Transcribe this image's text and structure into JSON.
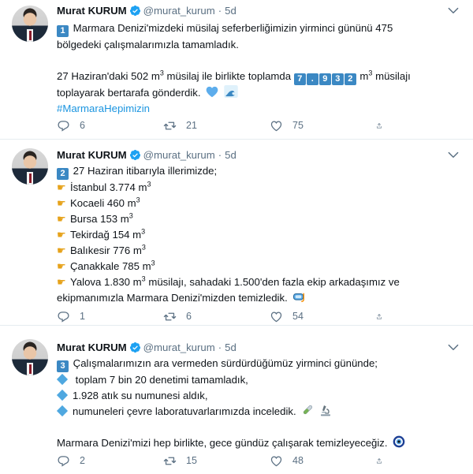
{
  "tweets": [
    {
      "name": "Murat KURUM",
      "handle": "@murat_kurum",
      "dot": "·",
      "time": "5d",
      "number_badge": "1",
      "lines": [
        "Marmara Denizi'mizdeki müsilaj seferberliğimizin yirminci gününü 475",
        "bölgedeki çalışmalarımızla tamamladık.",
        "27 Haziran'daki 502 m",
        " müsilaj ile birlikte toplamda ",
        " m",
        " müsilajı",
        "toplayarak bertarafa gönderdik."
      ],
      "superscript": "3",
      "total_digits": [
        "7",
        ".",
        "9",
        "3",
        "2"
      ],
      "hashtag": "#MarmaraHepimizin",
      "replies": "6",
      "retweets": "21",
      "likes": "75"
    },
    {
      "name": "Murat KURUM",
      "handle": "@murat_kurum",
      "dot": "·",
      "time": "5d",
      "number_badge": "2",
      "intro": "27 Haziran itibarıyla illerimizde;",
      "cities": [
        {
          "label": "İstanbul 3.774 m"
        },
        {
          "label": "Kocaeli 460 m"
        },
        {
          "label": "Bursa 153 m"
        },
        {
          "label": "Tekirdağ 154 m"
        },
        {
          "label": "Balıkesir 776 m"
        },
        {
          "label": "Çanakkale 785 m"
        }
      ],
      "yalova_a": "Yalova 1.830 m",
      "yalova_b": " müsilajı, sahadaki 1.500'den fazla ekip arkadaşımız ve",
      "closing": "ekipmanımızla Marmara Denizi'mizden temizledik.",
      "superscript": "3",
      "replies": "1",
      "retweets": "6",
      "likes": "54"
    },
    {
      "name": "Murat KURUM",
      "handle": "@murat_kurum",
      "dot": "·",
      "time": "5d",
      "number_badge": "3",
      "intro": "Çalışmalarımızın ara vermeden sürdürdüğümüz yirminci gününde;",
      "bullets": [
        "toplam 7 bin 20 denetimi tamamladık,",
        "1.928 atık su numunesi aldık,",
        "numuneleri çevre laboratuvarlarımızda inceledik."
      ],
      "closing": "Marmara Denizi'mizi hep birlikte, gece gündüz çalışarak temizleyeceğiz.",
      "replies": "2",
      "retweets": "15",
      "likes": "48"
    }
  ],
  "icons": {
    "verified": "verified-badge-icon",
    "more": "chevron-down-icon",
    "reply": "reply-icon",
    "retweet": "retweet-icon",
    "like": "heart-icon",
    "share": "share-icon"
  },
  "colors": {
    "accent": "#1da1f2",
    "hashtag": "#1b95e0",
    "muted": "#5b7083",
    "divider": "#e6ecf0"
  }
}
